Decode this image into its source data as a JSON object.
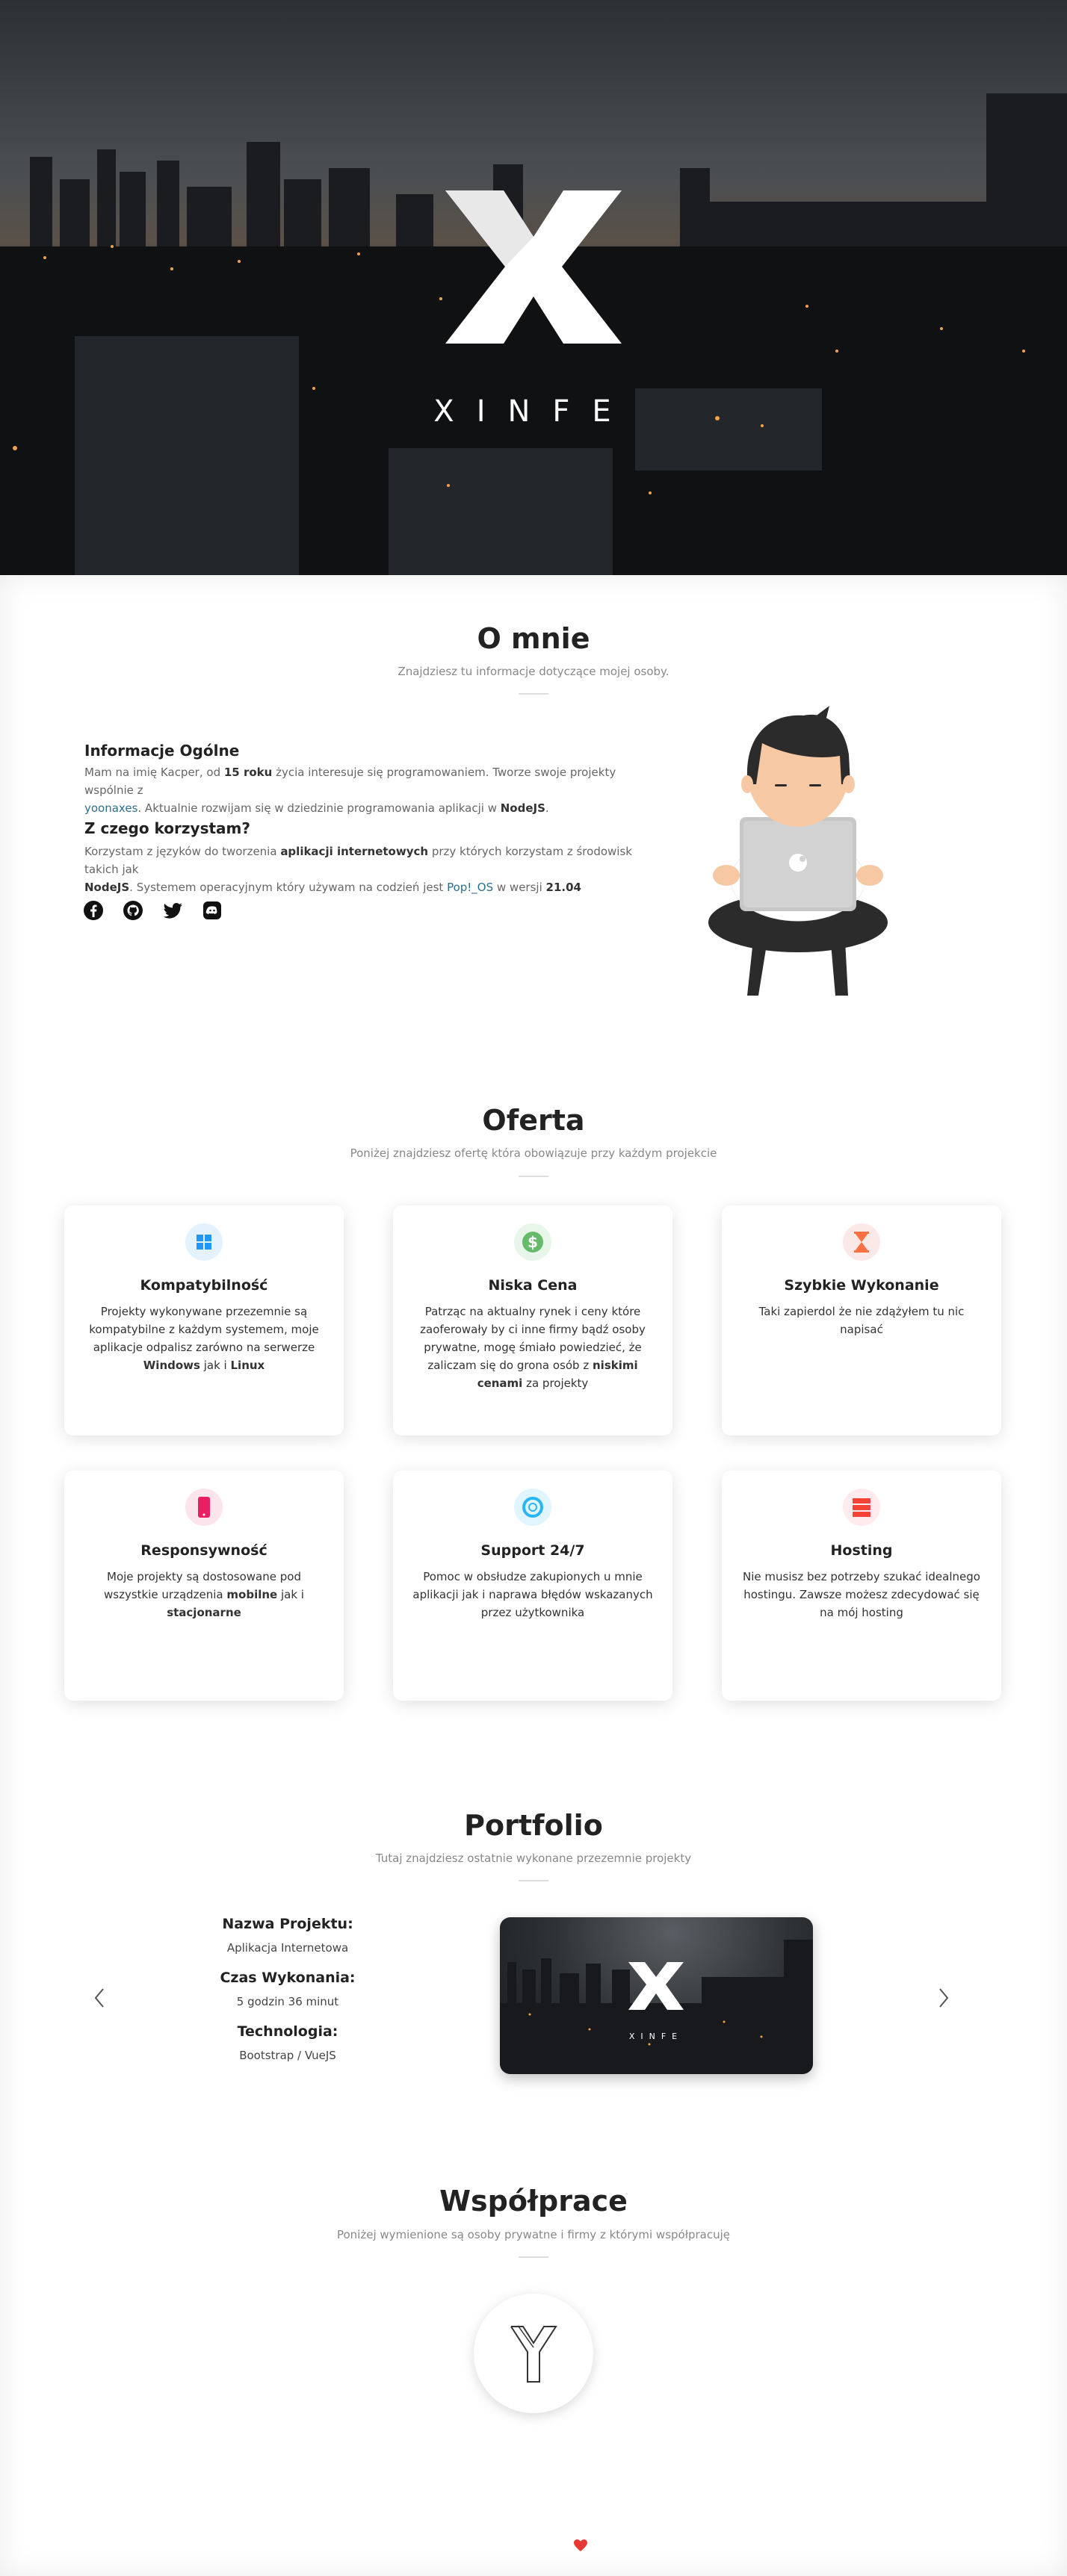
{
  "hero": {
    "brand": "XINFE",
    "logo_icon": "x-logo-icon"
  },
  "about": {
    "title": "O mnie",
    "subtitle": "Znajdziesz tu informacje dotyczące mojej osoby.",
    "general_heading": "Informacje Ogólne",
    "general_text_1": "Mam na imię Kacper, od ",
    "general_age": "15 roku",
    "general_text_2": " życia interesuje się programowaniem. Tworze swoje projekty wspólnie z",
    "general_link": "yoonaxes",
    "general_text_3": ". Aktualnie rozwijam się w dziedzinie programowania aplikacji w ",
    "general_tech": "NodeJS",
    "general_text_4": ".",
    "tools_heading": "Z czego korzystam?",
    "tools_text_1": "Korzystam z języków do tworzenia ",
    "tools_bold_1": "aplikacji internetowych",
    "tools_text_2": " przy których korzystam z środowisk takich jak",
    "tools_bold_2": "NodeJS",
    "tools_text_3": ". Systemem operacyjnym który używam na codzień jest ",
    "tools_link": "Pop!_OS",
    "tools_text_4": " w wersji ",
    "tools_version": "21.04",
    "socials": [
      "facebook-icon",
      "github-icon",
      "twitter-icon",
      "discord-icon"
    ]
  },
  "offer": {
    "title": "Oferta",
    "subtitle": "Poniżej znajdziesz ofertę która obowiązuje przy każdym projekcie",
    "cards": [
      {
        "title": "Kompatybilność",
        "icon": "windows-icon",
        "color": "#2196f3",
        "bg": "#e3f2fd",
        "d1": "Projekty wykonywane przezemnie są kompatybilne z każdym systemem, moje aplikacje odpalisz zarówno na serwerze ",
        "b1": "Windows",
        "d2": " jak i ",
        "b2": "Linux",
        "d3": ""
      },
      {
        "title": "Niska Cena",
        "icon": "dollar-icon",
        "color": "#4caf50",
        "bg": "#e8f5e9",
        "d1": "Patrząc na aktualny rynek i ceny które zaoferowały by ci inne firmy bądź osoby prywatne, mogę śmiało powiedzieć, że zaliczam się do grona osób z ",
        "b1": "niskimi cenami",
        "d2": " za projekty",
        "b2": "",
        "d3": ""
      },
      {
        "title": "Szybkie Wykonanie",
        "icon": "hourglass-icon",
        "color": "#ff7043",
        "bg": "#fbe9e7",
        "d1": "Taki zapierdol że nie zdążyłem tu nic napisać",
        "b1": "",
        "d2": "",
        "b2": "",
        "d3": ""
      },
      {
        "title": "Responsywność",
        "icon": "mobile-icon",
        "color": "#e91e63",
        "bg": "#fce4ec",
        "d1": "Moje projekty są dostosowane pod wszystkie urządzenia ",
        "b1": "mobilne",
        "d2": " jak i ",
        "b2": "stacjonarne",
        "d3": ""
      },
      {
        "title": "Support 24/7",
        "icon": "lifebuoy-icon",
        "color": "#29b6f6",
        "bg": "#e1f5fe",
        "d1": "Pomoc w obsłudze zakupionych u mnie aplikacji jak i naprawa błędów wskazanych przez użytkownika",
        "b1": "",
        "d2": "",
        "b2": "",
        "d3": ""
      },
      {
        "title": "Hosting",
        "icon": "server-icon",
        "color": "#f44336",
        "bg": "#ffebee",
        "d1": "Nie musisz bez potrzeby szukać idealnego hostingu. Zawsze możesz zdecydować się na mój hosting",
        "b1": "",
        "d2": "",
        "b2": "",
        "d3": ""
      }
    ]
  },
  "portfolio": {
    "title": "Portfolio",
    "subtitle": "Tutaj znajdziesz ostatnie wykonane przezemnie projekty",
    "name_label": "Nazwa Projektu:",
    "name_value": "Aplikacja Internetowa",
    "time_label": "Czas Wykonania:",
    "time_value": "5 godzin 36 minut",
    "tech_label": "Technologia:",
    "tech_value": "Bootstrap / VueJS",
    "preview_brand": "XINFE"
  },
  "partners": {
    "title": "Współprace",
    "subtitle": "Poniżej wymienione są osoby prywatne i firmy z którymi współpracuję"
  },
  "footer": {
    "icon": "heart-icon"
  }
}
